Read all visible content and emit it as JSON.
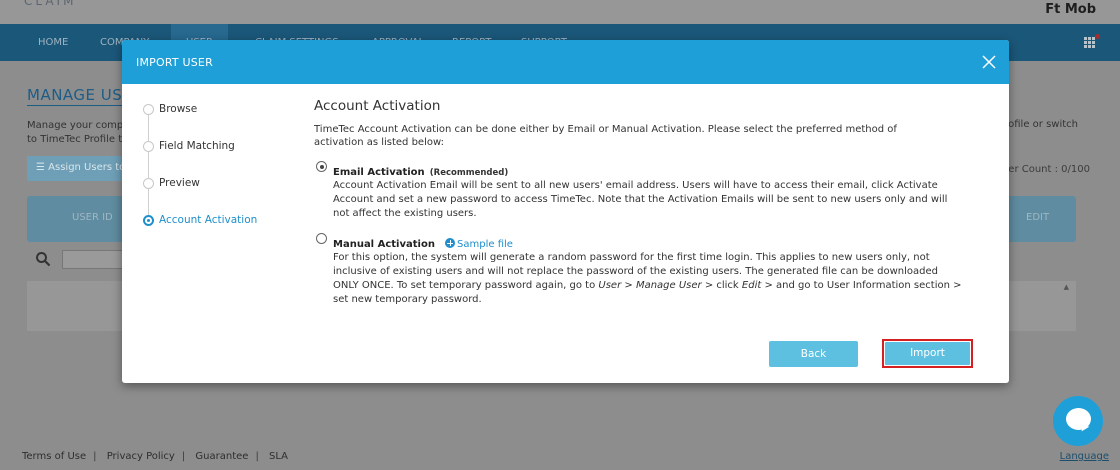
{
  "app": {
    "logo": "CLAIM",
    "user_name": "Ft Mob",
    "nav": [
      "HOME",
      "COMPANY",
      "USER",
      "CLAIM SETTINGS",
      "APPROVAL",
      "REPORT",
      "SUPPORT"
    ],
    "page_title": "MANAGE USER",
    "page_desc": "Manage your compa... to TimeTec Profile t...",
    "page_desc_right": "rofile or switch",
    "assign_button": "Assign Users to",
    "user_count": "ser Count : 0/100",
    "table_headers": [
      "USER ID",
      "EDIT"
    ],
    "footer_links": [
      "Terms of Use",
      "Privacy Policy",
      "Guarantee",
      "SLA"
    ],
    "language_link": "Language"
  },
  "modal": {
    "title": "IMPORT USER",
    "steps": [
      {
        "label": "Browse",
        "active": false
      },
      {
        "label": "Field Matching",
        "active": false
      },
      {
        "label": "Preview",
        "active": false
      },
      {
        "label": "Account Activation",
        "active": true
      }
    ],
    "section_title": "Account Activation",
    "intro": "TimeTec Account Activation can be done either by Email or Manual Activation. Please select the preferred method of activation as listed below:",
    "email_option": {
      "title": "Email Activation",
      "tag": "(Recommended)",
      "selected": true,
      "description": "Account Activation Email will be sent to all new users' email address. Users will have to access their email, click Activate Account and set a new password to access TimeTec. Note that the Activation Emails will be sent to new users only and will not affect the existing users."
    },
    "manual_option": {
      "title": "Manual Activation",
      "selected": false,
      "sample_link": "Sample file",
      "description_part1": "For this option, the system will generate a random password for the first time login. This applies to new users only, not inclusive of existing users and will not replace the password of the existing users. The generated file can be downloaded ONLY ONCE. To set temporary password again, go to ",
      "path_user": "User",
      "gt1": " > ",
      "path_manage": "Manage User",
      "description_part2": " > click ",
      "path_edit": "Edit",
      "description_part3": " > and go to User Information section > set new temporary password."
    },
    "back_button": "Back",
    "import_button": "Import"
  },
  "colors": {
    "modal_header": "#1e9fd8",
    "button": "#5ec0e0",
    "highlight_border": "#d42020",
    "active_step": "#1e8fcc"
  }
}
